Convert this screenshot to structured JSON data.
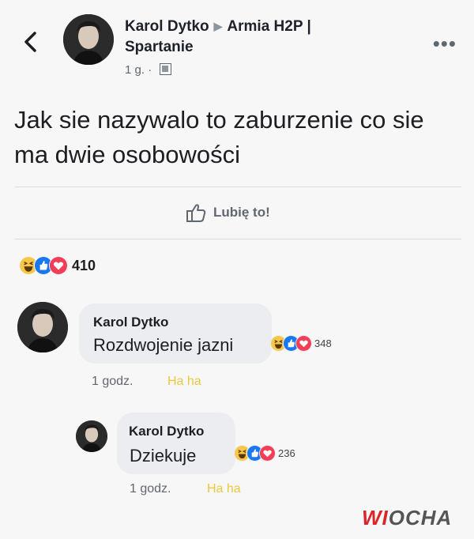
{
  "header": {
    "back_icon": "chevron-left-icon",
    "poster_name": "Karol Dytko",
    "group_name": "Armia H2P | Spartanie",
    "time": "1 g.",
    "privacy_icon": "group-icon",
    "more_icon": "ellipsis-icon"
  },
  "post": {
    "text": "Jak sie nazywalo to zaburzenie co sie ma dwie osobowości"
  },
  "actions": {
    "like_label": "Lubię to!",
    "like_icon": "thumbs-up-icon"
  },
  "reactions": {
    "icons": [
      "haha-icon",
      "like-icon",
      "love-icon"
    ],
    "count": "410"
  },
  "comments": [
    {
      "author": "Karol Dytko",
      "text": "Rozdwojenie jazni",
      "reaction_count": "348",
      "time": "1 godz.",
      "reaction_label": "Ha ha"
    },
    {
      "author": "Karol Dytko",
      "text": "Dziekuje",
      "reaction_count": "236",
      "time": "1 godz.",
      "reaction_label": "Ha ha"
    }
  ],
  "watermark": {
    "part1": "WI",
    "part2": "OCHA"
  },
  "colors": {
    "like_blue": "#1877f2",
    "love_red": "#f33e58",
    "haha_yellow": "#f7c74b",
    "haha_text": "#e9c93d"
  }
}
